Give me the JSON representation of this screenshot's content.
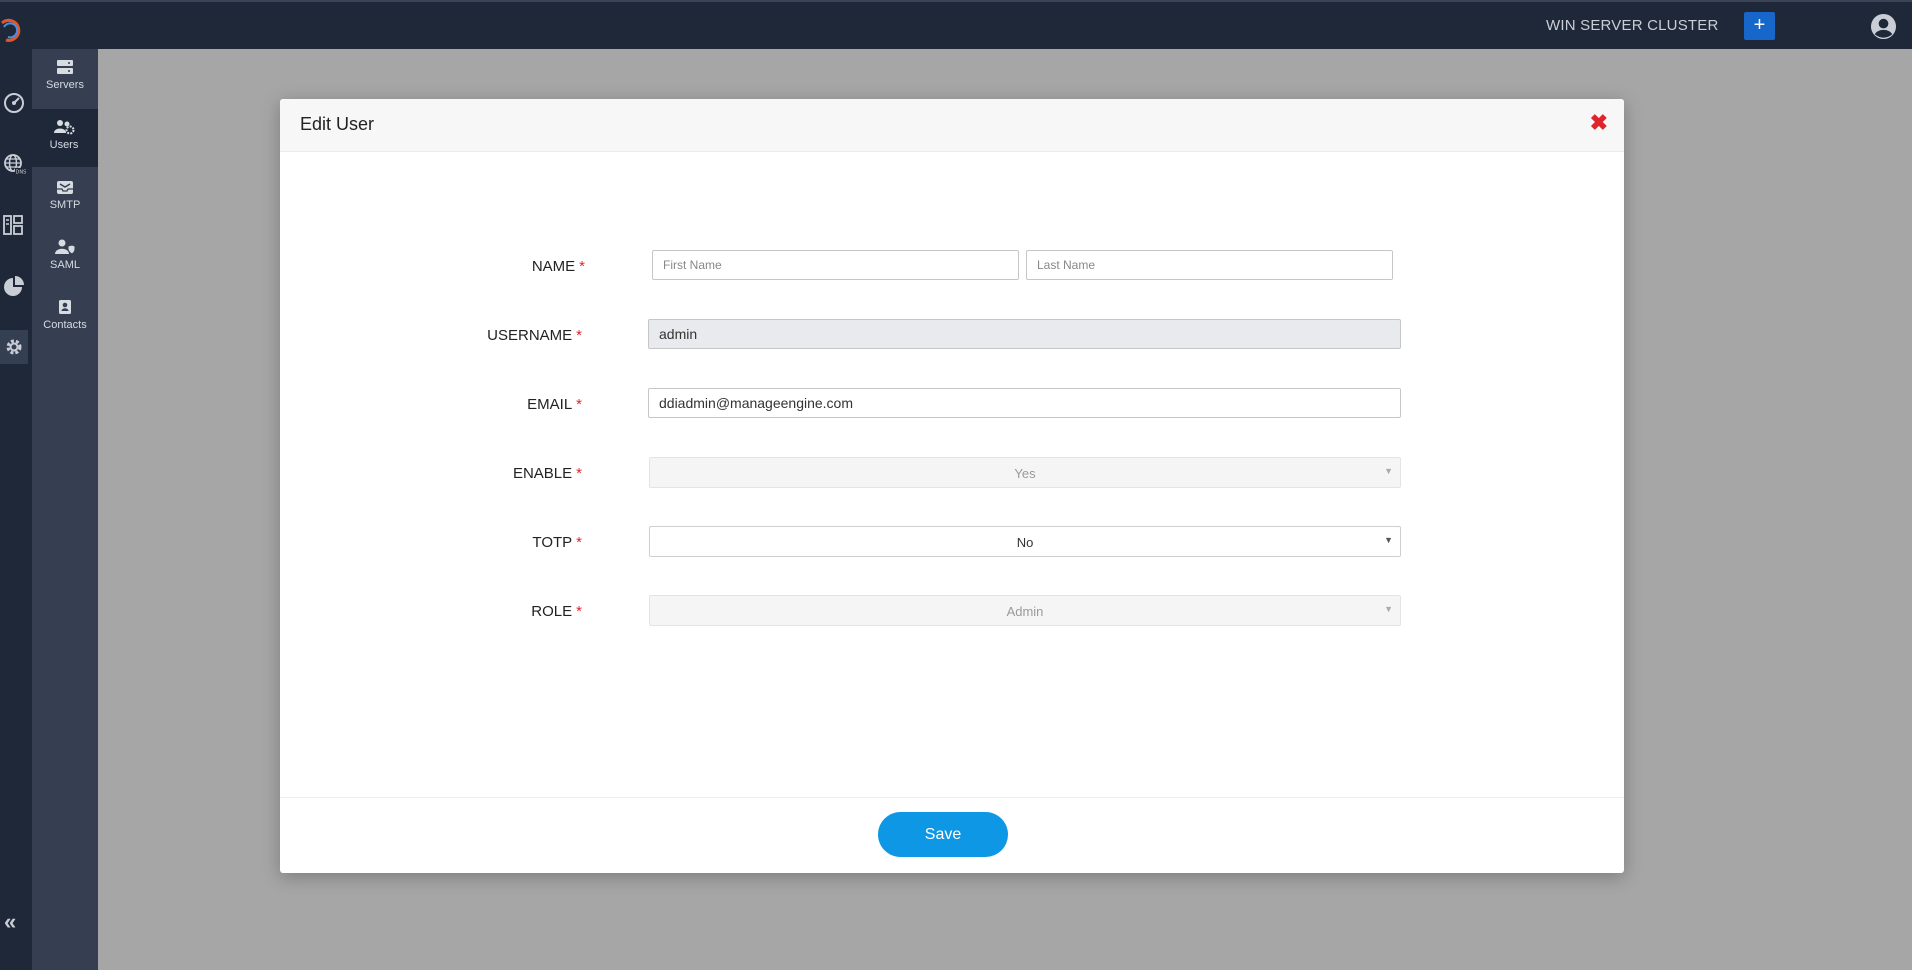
{
  "header": {
    "cluster_name": "WIN SERVER CLUSTER",
    "add_label": "+"
  },
  "subnav": {
    "items": [
      {
        "label": "Servers",
        "icon": "servers-icon"
      },
      {
        "label": "Users",
        "icon": "users-gear-icon",
        "active": true
      },
      {
        "label": "SMTP",
        "icon": "mail-tray-icon"
      },
      {
        "label": "SAML",
        "icon": "user-shield-icon"
      },
      {
        "label": "Contacts",
        "icon": "contact-book-icon"
      }
    ]
  },
  "rail": {
    "icons": [
      "dashboard-icon",
      "dns-globe-icon",
      "ipam-icon",
      "reports-pie-icon",
      "settings-gear-icon"
    ],
    "collapse_label": "«"
  },
  "modal": {
    "title": "Edit User",
    "close_label": "✖",
    "fields": {
      "name": {
        "label": "NAME",
        "first_placeholder": "First Name",
        "last_placeholder": "Last Name",
        "first_value": "",
        "last_value": ""
      },
      "username": {
        "label": "USERNAME",
        "value": "admin"
      },
      "email": {
        "label": "EMAIL",
        "value": "ddiadmin@manageengine.com"
      },
      "enable": {
        "label": "ENABLE",
        "value": "Yes"
      },
      "totp": {
        "label": "TOTP",
        "value": "No"
      },
      "role": {
        "label": "ROLE",
        "value": "Admin"
      }
    },
    "required_marker": "*",
    "save_label": "Save"
  },
  "colors": {
    "topbar": "#1f2838",
    "subnav": "#353f51",
    "accent": "#0d97e4",
    "required": "#e0242b",
    "add_button": "#1667c9"
  }
}
